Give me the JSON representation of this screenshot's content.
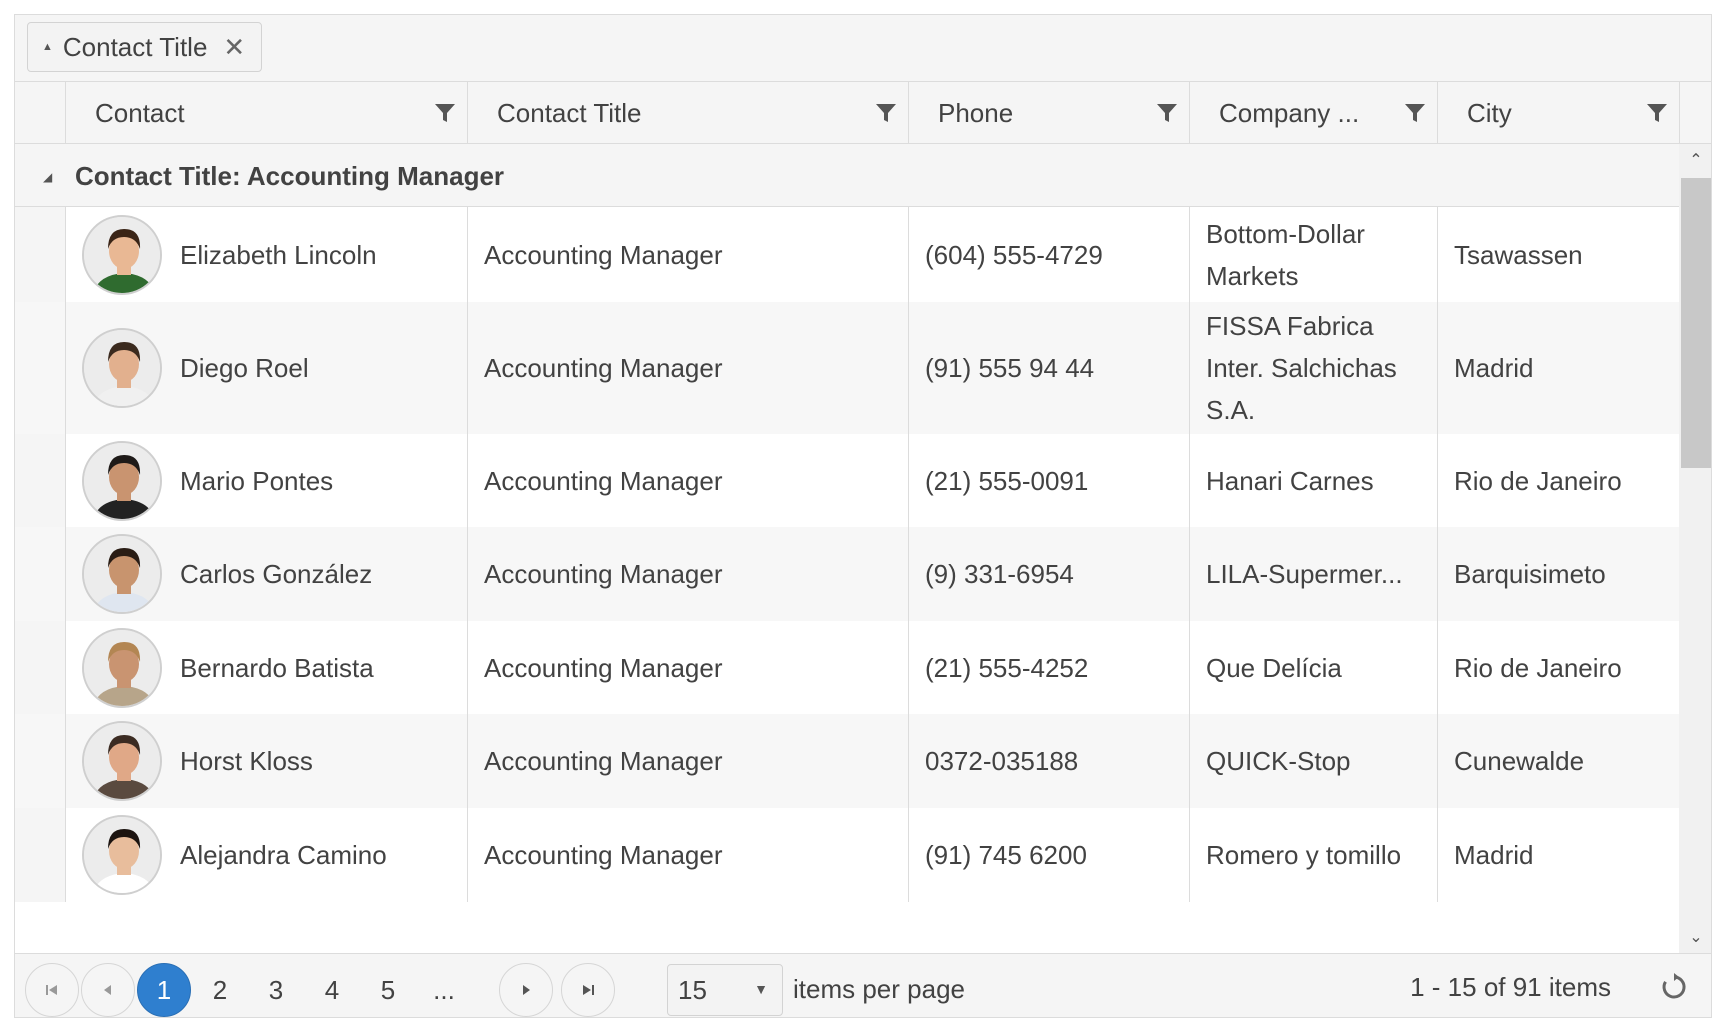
{
  "group_panel": {
    "chip_label": "Contact Title",
    "sort_icon": "sort-asc-icon",
    "close_icon": "close-icon"
  },
  "columns": [
    {
      "label": "Contact"
    },
    {
      "label": "Contact Title"
    },
    {
      "label": "Phone"
    },
    {
      "label": "Company ..."
    },
    {
      "label": "City"
    }
  ],
  "group": {
    "title": "Contact Title: Accounting Manager"
  },
  "rows": [
    {
      "name": "Elizabeth Lincoln",
      "title": "Accounting Manager",
      "phone": "(604) 555-4729",
      "company": "Bottom-Dollar Markets",
      "city": "Tsawassen",
      "avatar": {
        "skin": "#e9b894",
        "hair": "#3a2416",
        "shirt": "#2f6b2f"
      }
    },
    {
      "name": "Diego Roel",
      "title": "Accounting Manager",
      "phone": "(91) 555 94 44",
      "company": "FISSA Fabrica Inter. Salchichas S.A.",
      "city": "Madrid",
      "avatar": {
        "skin": "#e2b08e",
        "hair": "#3b2a1e",
        "shirt": "#f0f0f0"
      }
    },
    {
      "name": "Mario Pontes",
      "title": "Accounting Manager",
      "phone": "(21) 555-0091",
      "company": "Hanari Carnes",
      "city": "Rio de Janeiro",
      "avatar": {
        "skin": "#c99470",
        "hair": "#1e1a18",
        "shirt": "#222222"
      }
    },
    {
      "name": "Carlos González",
      "title": "Accounting Manager",
      "phone": "(9) 331-6954",
      "company": "LILA-Supermer...",
      "city": "Barquisimeto",
      "avatar": {
        "skin": "#c8946e",
        "hair": "#2a1d15",
        "shirt": "#dfe6f0"
      }
    },
    {
      "name": "Bernardo Batista",
      "title": "Accounting Manager",
      "phone": "(21) 555-4252",
      "company": "Que Delícia",
      "city": "Rio de Janeiro",
      "avatar": {
        "skin": "#c99471",
        "hair": "#b38653",
        "shirt": "#b7a58a"
      }
    },
    {
      "name": "Horst Kloss",
      "title": "Accounting Manager",
      "phone": "0372-035188",
      "company": "QUICK-Stop",
      "city": "Cunewalde",
      "avatar": {
        "skin": "#e0a887",
        "hair": "#3b2b22",
        "shirt": "#5a4a3f"
      }
    },
    {
      "name": "Alejandra Camino",
      "title": "Accounting Manager",
      "phone": "(91) 745 6200",
      "company": "Romero y tomillo",
      "city": "Madrid",
      "avatar": {
        "skin": "#e8bd9c",
        "hair": "#1c1410",
        "shirt": "#ffffff"
      }
    }
  ],
  "pager": {
    "pages": [
      "1",
      "2",
      "3",
      "4",
      "5",
      "..."
    ],
    "current_page": "1",
    "page_size": "15",
    "items_per_page_label": "items per page",
    "info": "1 - 15 of 91 items"
  },
  "colors": {
    "accent": "#2f7fcf",
    "header_bg": "#f5f5f5",
    "border": "#dcdcdc",
    "text": "#424242"
  }
}
